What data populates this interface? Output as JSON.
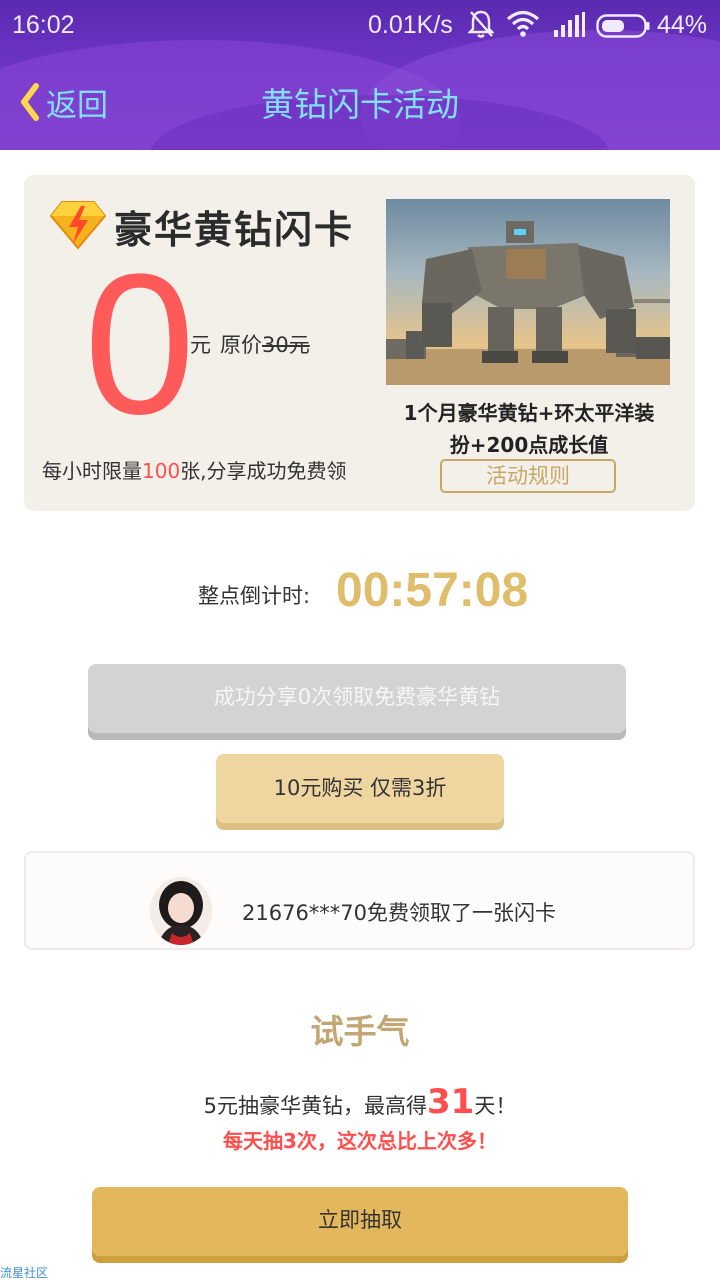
{
  "status_bar": {
    "time": "16:02",
    "speed": "0.01K/s",
    "battery_pct": "44%",
    "icons": [
      "bell-muted-icon",
      "wifi-icon",
      "signal-icon",
      "battery-icon"
    ]
  },
  "header": {
    "back_label": "返回",
    "title": "黄钻闪卡活动"
  },
  "card": {
    "brand": "豪华黄钻闪卡",
    "price": "0",
    "unit": "元",
    "orig_prefix": "原价",
    "orig_price": "30元",
    "limit_prefix": "每小时限量",
    "limit_count": "100",
    "limit_suffix": "张,分享成功免费领",
    "gift_line1": "1个月豪华黄钻+环太平洋装",
    "gift_line2": "扮+200点成长值",
    "rules_label": "活动规则"
  },
  "countdown": {
    "label": "整点倒计时:",
    "time": "00:57:08"
  },
  "buttons": {
    "share_label": "成功分享0次领取免费豪华黄钻",
    "buy_label": "10元购买 仅需3折",
    "draw_label": "立即抽取"
  },
  "feed": {
    "message": "21676***70免费领取了一张闪卡"
  },
  "luck": {
    "title": "试手气",
    "desc_prefix": "5元抽豪华黄钻，最高得",
    "desc_days": "31",
    "desc_suffix": "天！",
    "sub": "每天抽3次，这次总比上次多！"
  },
  "watermark": "流星社区",
  "colors": {
    "accent_red": "#ff5a5a",
    "gold": "#e0bd6a",
    "header_purple": "#6d34c4",
    "header_text": "#7fe0ff"
  }
}
